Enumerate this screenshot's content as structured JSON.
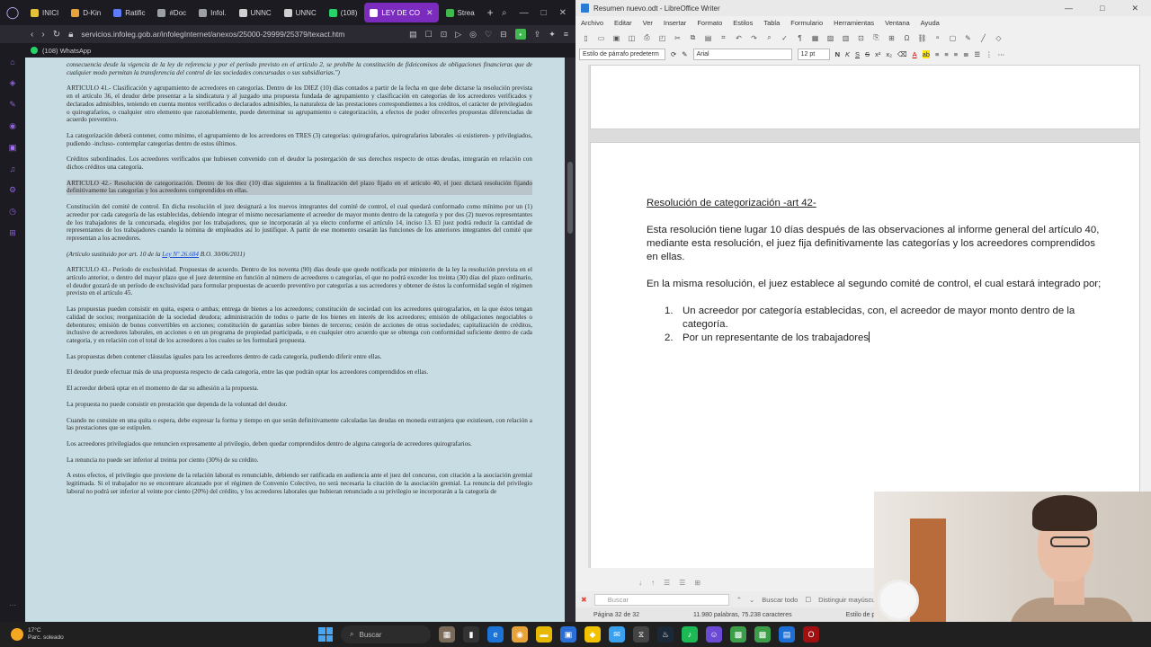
{
  "browser": {
    "tabs": [
      {
        "label": "INICI",
        "color": "#e3c23a"
      },
      {
        "label": "D-Kin",
        "color": "#e6a43a"
      },
      {
        "label": "Ratific",
        "color": "#5c7cfa"
      },
      {
        "label": "#Doc",
        "color": "#9aa0a6"
      },
      {
        "label": "Infol.",
        "color": "#9aa0a6"
      },
      {
        "label": "UNNC",
        "color": "#cfcfcf"
      },
      {
        "label": "UNNC",
        "color": "#cfcfcf"
      },
      {
        "label": "(108)",
        "color": "#25d366"
      },
      {
        "label": "LEY DE CO",
        "color": "#ffffff",
        "active": true
      },
      {
        "label": "Strea",
        "color": "#3fb950"
      }
    ],
    "url": "servicios.infoleg.gob.ar/infolegInternet/anexos/25000-29999/25379/texact.htm",
    "whatsapp_label": "(108) WhatsApp"
  },
  "document": {
    "p0": "consecuencia desde la vigencia de la ley de referencia y por el período previsto en el artículo 2, se prohíbe la constitución de fideicomisos de obligaciones financieras que de cualquier modo permitan la transferencia del control de las sociedades concursadas o sus subsidiarias.\")",
    "p1": "ARTICULO 41.- Clasificación y agrupamiento de acreedores en categorías. Dentro de los DIEZ (10) días contados a partir de la fecha en que debe dictarse la resolución prevista en el artículo 36, el deudor debe presentar a la sindicatura y al juzgado una propuesta fundada de agrupamiento y clasificación en categorías de los acreedores verificados y declarados admisibles, teniendo en cuenta montos verificados o declarados admisibles, la naturaleza de las prestaciones correspondientes a los créditos, el carácter de privilegiados o quirografarios, o cualquier otro elemento que razonablemente, puede determinar su agrupamiento o categorización, a efectos de poder ofrecerles propuestas diferenciadas de acuerdo preventivo.",
    "p2": "La categorización deberá contener, como mínimo, el agrupamiento de los acreedores en TRES (3) categorías: quirografarios, quirografarios laborales -si existieren- y privilegiados, pudiendo -incluso- contemplar categorías dentro de estos últimos.",
    "p3": "Créditos subordinados. Los acreedores verificados que hubiesen convenido con el deudor la postergación de sus derechos respecto de otras deudas, integrarán en relación con dichos créditos una categoría.",
    "p4": "ARTICULO 42.- Resolución de categorización. Dentro de los diez (10) días siguientes a la finalización del plazo fijado en el artículo 40, el juez dictará resolución fijando definitivamente las categorías y los acreedores comprendidos en ellas.",
    "p5": "Constitución del comité de control. En dicha resolución el juez designará a los nuevos integrantes del comité de control, el cual quedará conformado como mínimo por un (1) acreedor por cada categoría de las establecidas, debiendo integrar el mismo necesariamente el acreedor de mayor monto dentro de la categoría y por dos (2) nuevos representantes de los trabajadores de la concursada, elegidos por los trabajadores, que se incorporarán al ya electo conforme el artículo 14, inciso 13. El juez podrá reducir la cantidad de representantes de los trabajadores cuando la nómina de empleados así lo justifique. A partir de ese momento cesarán las funciones de los anteriores integrantes del comité que representan a los acreedores.",
    "p6_prefix": "(Artículo sustituido por art. 10 de la ",
    "p6_link": "Ley Nº 26.684",
    "p6_suffix": " B.O. 30/06/2011)",
    "p7": "ARTICULO 43.- Período de exclusividad. Propuestas de acuerdo. Dentro de los noventa (90) días desde que quede notificada por ministerio de la ley la resolución prevista en el artículo anterior, o dentro del mayor plazo que el juez determine en función al número de acreedores o categorías, el que no podrá exceder los treinta (30) días del plazo ordinario, el deudor gozará de un período de exclusividad para formular propuestas de acuerdo preventivo por categorías a sus acreedores y obtener de éstos la conformidad según el régimen previsto en el artículo 45.",
    "p8": "Las propuestas pueden consistir en quita, espera o ambas; entrega de bienes a los acreedores; constitución de sociedad con los acreedores quirografarios, en la que éstos tengan calidad de socios; reorganización de la sociedad deudora; administración de todos o parte de los bienes en interés de los acreedores; emisión de obligaciones negociables o debentures; emisión de bonos convertibles en acciones; constitución de garantías sobre bienes de terceros; cesión de acciones de otras sociedades; capitalización de créditos, inclusive de acreedores laborales, en acciones o en un programa de propiedad participada, o en cualquier otro acuerdo que se obtenga con conformidad suficiente dentro de cada categoría, y en relación con el total de los acreedores a los cuales se les formulará propuesta.",
    "p9": "Las propuestas deben contener cláusulas iguales para los acreedores dentro de cada categoría, pudiendo diferir entre ellas.",
    "p10": "El deudor puede efectuar más de una propuesta respecto de cada categoría, entre las que podrán optar los acreedores comprendidos en ellas.",
    "p11": "El acreedor deberá optar en el momento de dar su adhesión a la propuesta.",
    "p12": "La propuesta no puede consistir en prestación que dependa de la voluntad del deudor.",
    "p13": "Cuando no consiste en una quita o espera, debe expresar la forma y tiempo en que serán definitivamente calculadas las deudas en moneda extranjera que existiesen, con relación a las prestaciones que se estipulen.",
    "p14": "Los acreedores privilegiados que renuncien expresamente al privilegio, deben quedar comprendidos dentro de alguna categoría de acreedores quirografarios.",
    "p15": "La renuncia no puede ser inferior al treinta por ciento (30%) de su crédito.",
    "p16": "A estos efectos, el privilegio que proviene de la relación laboral es renunciable, debiendo ser ratificada en audiencia ante el juez del concurso, con citación a la asociación gremial legitimada. Si el trabajador no se encontrare alcanzado por el régimen de Convenio Colectivo, no será necesaria la citación de la asociación gremial. La renuncia del privilegio laboral no podrá ser inferior al veinte por ciento (20%) del crédito, y los acreedores laborales que hubieran renunciado a su privilegio se incorporarán a la categoría de"
  },
  "writer": {
    "title": "Resumen nuevo.odt - LibreOffice Writer",
    "menu": [
      "Archivo",
      "Editar",
      "Ver",
      "Insertar",
      "Formato",
      "Estilos",
      "Tabla",
      "Formulario",
      "Herramientas",
      "Ventana",
      "Ayuda"
    ],
    "para_style": "Estilo de párrafo predeterm",
    "font": "Arial",
    "font_size": "12 pt",
    "heading": "Resolución de categorización -art 42-",
    "para1": "Esta resolución tiene lugar 10 días después de las observaciones al informe general del artículo 40, mediante esta resolución, el juez fija definitivamente las categorías y los acreedores comprendidos en ellas.",
    "para2": "En la misma resolución, el juez establece al segundo comité de control, el cual estará integrado por;",
    "list": [
      {
        "num": "1.",
        "text": "Un acreedor por categoría establecidas, con, el acreedor de mayor monto dentro de la categoría."
      },
      {
        "num": "2.",
        "text": "Por un representante de los trabajadores"
      }
    ],
    "find_placeholder": "Buscar",
    "find_all": "Buscar todo",
    "match_case": "Distinguir mayúsculas y minúsc",
    "status_page": "Página 32 de 32",
    "status_words": "11.980 palabras, 75.238 caracteres",
    "status_style": "Estilo de página pre"
  },
  "taskbar": {
    "temp": "17°C",
    "weather": "Parc. soleado",
    "search": "Buscar"
  }
}
